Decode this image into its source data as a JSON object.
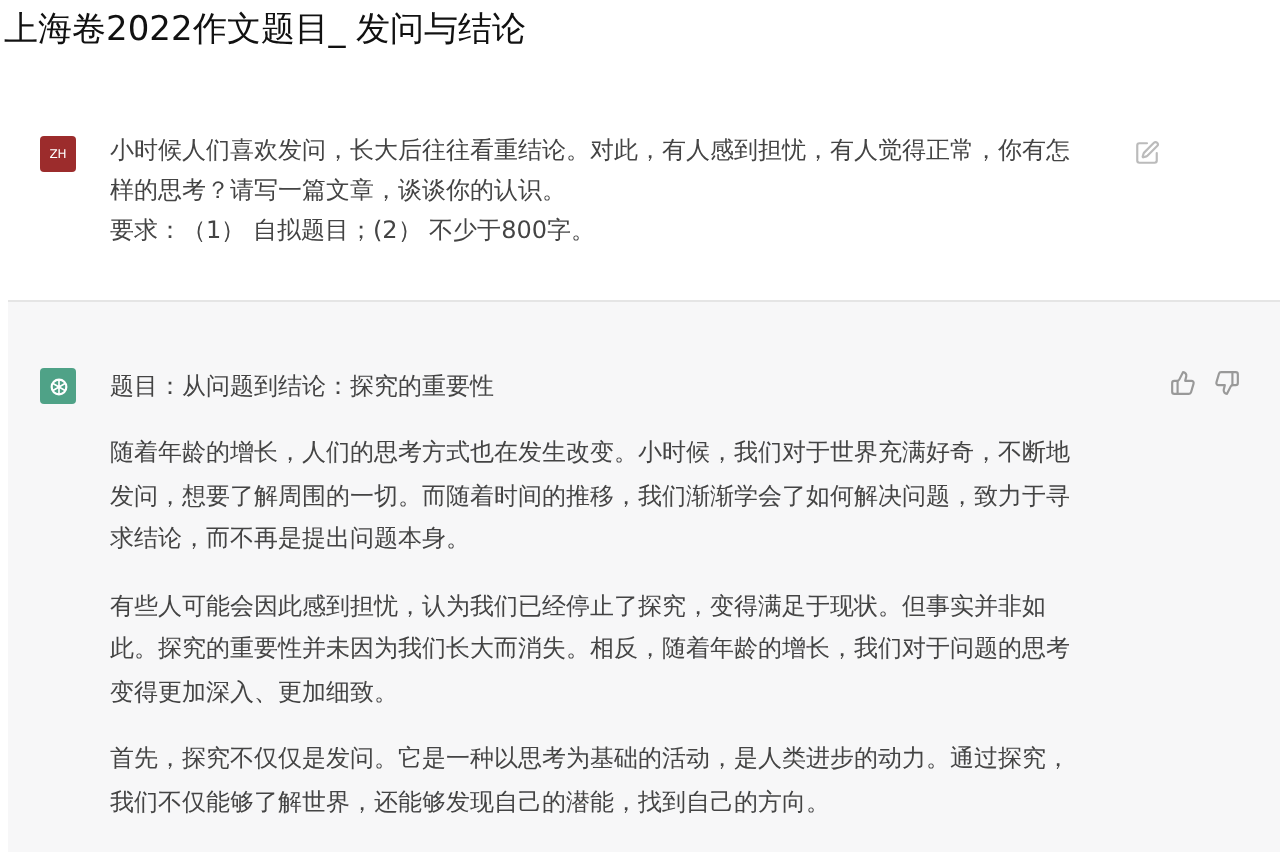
{
  "page_title": "上海卷2022作文题目_ 发问与结论",
  "user_message": {
    "avatar": "ZH",
    "lines": [
      "小时候人们喜欢发问，长大后往往看重结论。对此，有人感到担忧，有人觉得正常，你有怎样的思考？请写一篇文章，谈谈你的认识。",
      "要求：（1） 自拟题目；(2） 不少于800字。"
    ]
  },
  "assistant_message": {
    "heading": "题目：从问题到结论：探究的重要性",
    "paragraphs": [
      "随着年龄的增长，人们的思考方式也在发生改变。小时候，我们对于世界充满好奇，不断地发问，想要了解周围的一切。而随着时间的推移，我们渐渐学会了如何解决问题，致力于寻求结论，而不再是提出问题本身。",
      "有些人可能会因此感到担忧，认为我们已经停止了探究，变得满足于现状。但事实并非如此。探究的重要性并未因为我们长大而消失。相反，随着年龄的增长，我们对于问题的思考变得更加深入、更加细致。",
      "首先，探究不仅仅是发问。它是一种以思考为基础的活动，是人类进步的动力。通过探究，我们不仅能够了解世界，还能够发现自己的潜能，找到自己的方向。"
    ]
  }
}
